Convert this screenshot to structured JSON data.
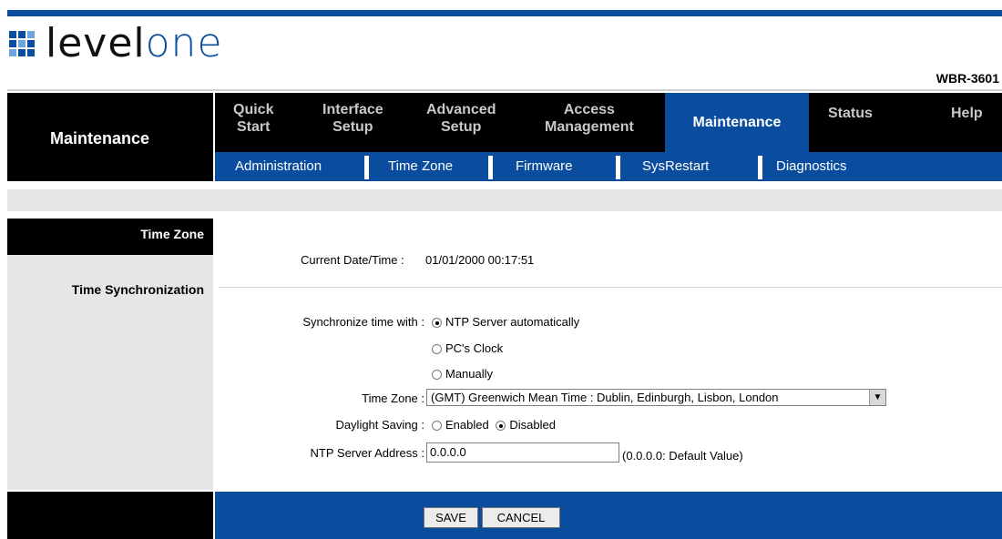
{
  "brand": {
    "logo_text_a": "level",
    "logo_text_b": "one",
    "model": "WBR-3601"
  },
  "section_title": "Maintenance",
  "nav": [
    {
      "label": "Quick\nStart"
    },
    {
      "label": "Interface\nSetup"
    },
    {
      "label": "Advanced\nSetup"
    },
    {
      "label": "Access\nManagement"
    },
    {
      "label": "Maintenance"
    },
    {
      "label": "Status"
    },
    {
      "label": "Help"
    }
  ],
  "subnav": [
    {
      "label": "Administration"
    },
    {
      "label": "Time Zone"
    },
    {
      "label": "Firmware"
    },
    {
      "label": "SysRestart"
    },
    {
      "label": "Diagnostics"
    }
  ],
  "left": {
    "time_zone": "Time Zone",
    "time_sync": "Time Synchronization"
  },
  "form": {
    "current_label": "Current Date/Time :",
    "current_value": "01/01/2000 00:17:51",
    "sync_label": "Synchronize time with :",
    "sync_options": [
      "NTP Server automatically",
      "PC's Clock",
      "Manually"
    ],
    "timezone_label": "Time Zone :",
    "timezone_value": "(GMT) Greenwich Mean Time : Dublin, Edinburgh, Lisbon, London",
    "dst_label": "Daylight Saving :",
    "dst_enabled": "Enabled",
    "dst_disabled": "Disabled",
    "ntp_label": "NTP Server Address :",
    "ntp_value": "0.0.0.0",
    "ntp_hint": "(0.0.0.0: Default Value)"
  },
  "buttons": {
    "save": "SAVE",
    "cancel": "CANCEL"
  },
  "colors": {
    "accent": "#0a4d9e",
    "nav_bg": "#000000",
    "panel_gray": "#e6e6e6"
  }
}
